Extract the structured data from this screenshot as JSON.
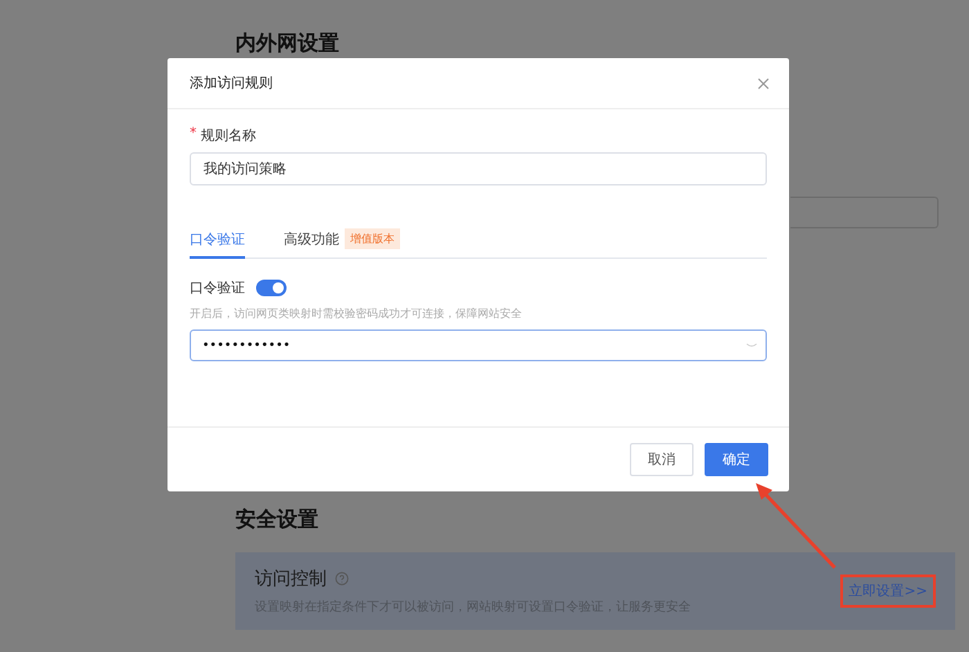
{
  "page": {
    "network_section_title": "内外网设置",
    "security_section_title": "安全设置",
    "access_control": {
      "title": "访问控制",
      "description": "设置映射在指定条件下才可以被访问，网站映射可设置口令验证，让服务更安全",
      "link": "立即设置>>",
      "highlighted": true
    }
  },
  "dialog": {
    "title": "添加访问规则",
    "name_field": {
      "label": "规则名称",
      "required_mark": "*",
      "value": "我的访问策略"
    },
    "tabs": [
      {
        "label": "口令验证",
        "selected": true
      },
      {
        "label": "高级功能",
        "badge": "增值版本",
        "selected": false
      }
    ],
    "password_toggle": {
      "label": "口令验证",
      "on": true
    },
    "hint": "开启后，访问网页类映射时需校验密码成功才可连接，保障网站安全",
    "password": {
      "value": "••••••••••••"
    },
    "buttons": [
      {
        "label": "取消",
        "kind": "secondary"
      },
      {
        "label": "确定",
        "kind": "primary"
      }
    ]
  }
}
